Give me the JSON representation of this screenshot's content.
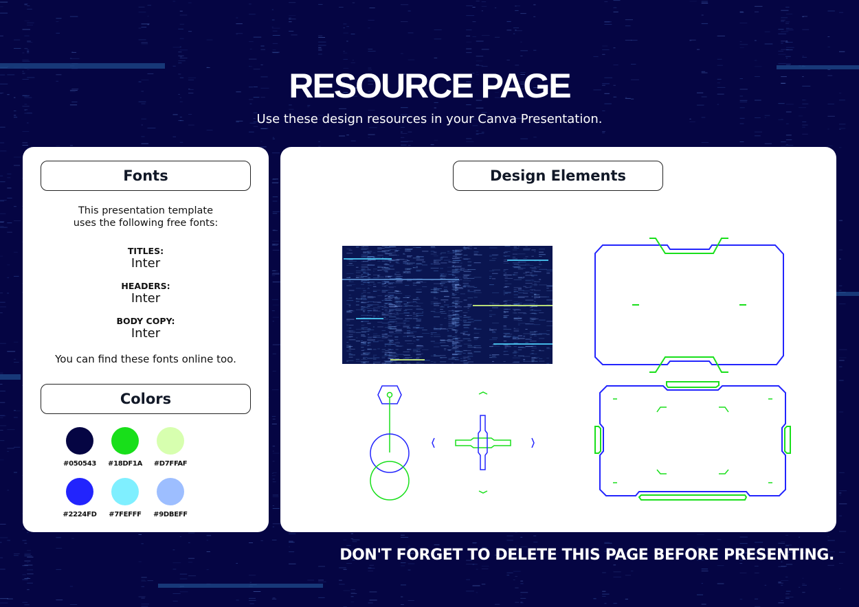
{
  "header": {
    "title": "RESOURCE PAGE",
    "subtitle": "Use these design resources in your Canva Presentation."
  },
  "fonts_panel": {
    "heading": "Fonts",
    "intro_line1": "This presentation template",
    "intro_line2": "uses the following free fonts:",
    "entries": [
      {
        "label": "TITLES:",
        "font": "Inter"
      },
      {
        "label": "HEADERS:",
        "font": "Inter"
      },
      {
        "label": "BODY COPY:",
        "font": "Inter"
      }
    ],
    "outro": "You can find these fonts online too."
  },
  "colors_panel": {
    "heading": "Colors",
    "swatches": [
      {
        "hex": "#050543",
        "label": "#050543"
      },
      {
        "hex": "#18DF1A",
        "label": "#18DF1A"
      },
      {
        "hex": "#D7FFAF",
        "label": "#D7FFAF"
      },
      {
        "hex": "#2224FD",
        "label": "#2224FD"
      },
      {
        "hex": "#7FEFFF",
        "label": "#7FEFFF"
      },
      {
        "hex": "#9DBEFF",
        "label": "#9DBEFF"
      }
    ]
  },
  "design_elements_panel": {
    "heading": "Design Elements",
    "items": [
      "data-texture-image",
      "hud-frame-notched",
      "hex-pendulum",
      "crosshair-with-chevrons",
      "hud-frame-tabs"
    ]
  },
  "footer": {
    "note": "DON'T FORGET TO DELETE THIS PAGE BEFORE PRESENTING."
  },
  "theme": {
    "background": "#050543",
    "line_blue": "#2224FD",
    "line_green": "#18DF1A"
  }
}
